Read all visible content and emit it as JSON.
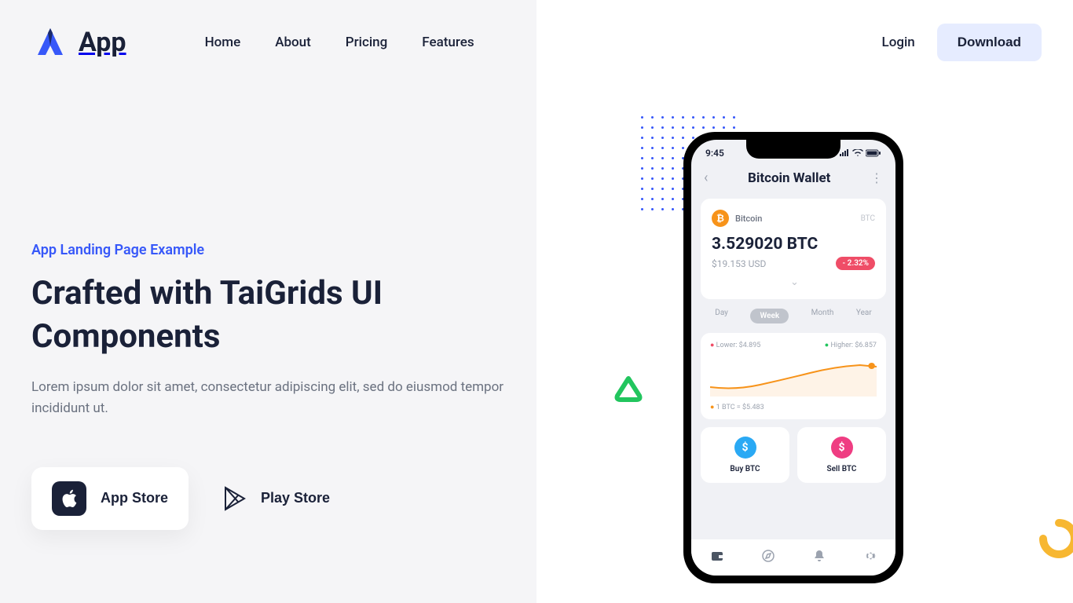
{
  "brand": "App",
  "nav": [
    "Home",
    "About",
    "Pricing",
    "Features"
  ],
  "login": "Login",
  "download": "Download",
  "hero": {
    "eyebrow": "App Landing Page Example",
    "title": "Crafted with TaiGrids UI Components",
    "desc": "Lorem ipsum dolor sit amet, consectetur adipiscing elit, sed do eiusmod tempor incididunt ut.",
    "appstore": "App Store",
    "playstore": "Play Store"
  },
  "phone": {
    "time": "9:45",
    "title": "Bitcoin Wallet",
    "coin_name": "Bitcoin",
    "coin_sym": "BTC",
    "balance": "3.529020 BTC",
    "usd": "$19.153 USD",
    "pct": "- 2.32%",
    "ranges": [
      "Day",
      "Week",
      "Month",
      "Year"
    ],
    "lower": "Lower: $4.895",
    "higher": "Higher: $6.857",
    "rate": "1 BTC = $5.483",
    "buy": "Buy BTC",
    "sell": "Sell BTC"
  }
}
